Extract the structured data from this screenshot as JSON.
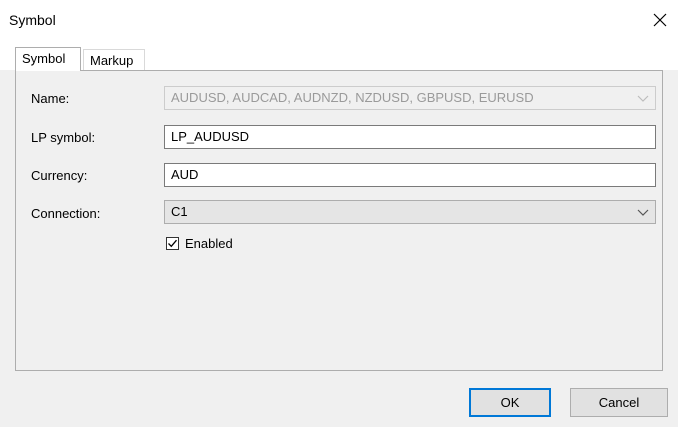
{
  "window": {
    "title": "Symbol"
  },
  "tabs": [
    {
      "label": "Symbol",
      "active": true
    },
    {
      "label": "Markup",
      "active": false
    }
  ],
  "form": {
    "name_label": "Name:",
    "name_value": "AUDUSD, AUDCAD, AUDNZD, NZDUSD, GBPUSD, EURUSD",
    "lp_symbol_label": "LP symbol:",
    "lp_symbol_value": "LP_AUDUSD",
    "currency_label": "Currency:",
    "currency_value": "AUD",
    "connection_label": "Connection:",
    "connection_value": "C1",
    "enabled_label": "Enabled",
    "enabled_checked": true
  },
  "buttons": {
    "ok": "OK",
    "cancel": "Cancel"
  },
  "icons": {
    "close": "close-icon",
    "chevron": "chevron-down-icon",
    "check": "checkmark-icon"
  },
  "colors": {
    "focus_border": "#0078d7",
    "panel_bg": "#f0f0f0"
  }
}
